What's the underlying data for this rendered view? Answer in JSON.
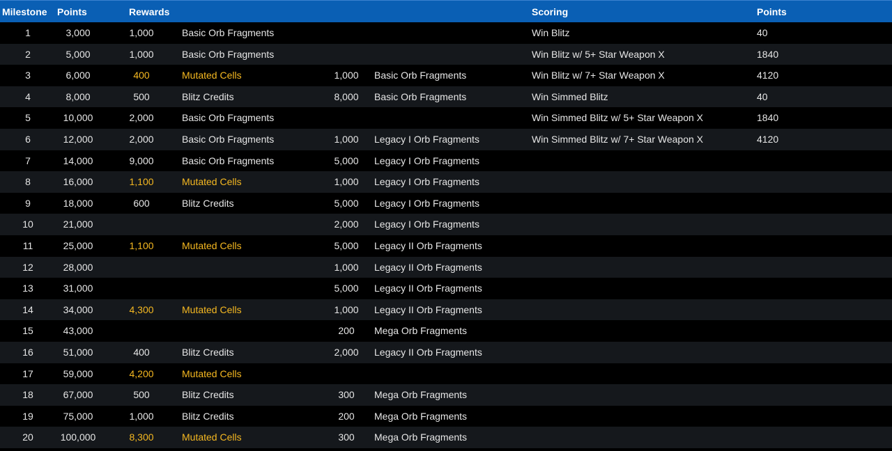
{
  "colors": {
    "header_bg": "#0a5fb4",
    "row_even": "#000000",
    "row_odd": "#15181c",
    "highlight": "#f5b821",
    "text": "#e6e6e6"
  },
  "headers": {
    "milestone": "Milestone",
    "points": "Points",
    "rewards": "Rewards",
    "scoring": "Scoring",
    "scoring_points": "Points"
  },
  "milestones": [
    {
      "n": "1",
      "points": "3,000",
      "r1_qty": "1,000",
      "r1_item": "Basic Orb Fragments",
      "r1_highlight": false,
      "r2_qty": "",
      "r2_item": ""
    },
    {
      "n": "2",
      "points": "5,000",
      "r1_qty": "1,000",
      "r1_item": "Basic Orb Fragments",
      "r1_highlight": false,
      "r2_qty": "",
      "r2_item": ""
    },
    {
      "n": "3",
      "points": "6,000",
      "r1_qty": "400",
      "r1_item": "Mutated Cells",
      "r1_highlight": true,
      "r2_qty": "1,000",
      "r2_item": "Basic Orb Fragments"
    },
    {
      "n": "4",
      "points": "8,000",
      "r1_qty": "500",
      "r1_item": "Blitz Credits",
      "r1_highlight": false,
      "r2_qty": "8,000",
      "r2_item": "Basic Orb Fragments"
    },
    {
      "n": "5",
      "points": "10,000",
      "r1_qty": "2,000",
      "r1_item": "Basic Orb Fragments",
      "r1_highlight": false,
      "r2_qty": "",
      "r2_item": ""
    },
    {
      "n": "6",
      "points": "12,000",
      "r1_qty": "2,000",
      "r1_item": "Basic Orb Fragments",
      "r1_highlight": false,
      "r2_qty": "1,000",
      "r2_item": "Legacy I Orb Fragments"
    },
    {
      "n": "7",
      "points": "14,000",
      "r1_qty": "9,000",
      "r1_item": "Basic Orb Fragments",
      "r1_highlight": false,
      "r2_qty": "5,000",
      "r2_item": "Legacy I Orb Fragments"
    },
    {
      "n": "8",
      "points": "16,000",
      "r1_qty": "1,100",
      "r1_item": "Mutated Cells",
      "r1_highlight": true,
      "r2_qty": "1,000",
      "r2_item": "Legacy I Orb Fragments"
    },
    {
      "n": "9",
      "points": "18,000",
      "r1_qty": "600",
      "r1_item": "Blitz Credits",
      "r1_highlight": false,
      "r2_qty": "5,000",
      "r2_item": "Legacy I Orb Fragments"
    },
    {
      "n": "10",
      "points": "21,000",
      "r1_qty": "",
      "r1_item": "",
      "r1_highlight": false,
      "r2_qty": "2,000",
      "r2_item": "Legacy I Orb Fragments"
    },
    {
      "n": "11",
      "points": "25,000",
      "r1_qty": "1,100",
      "r1_item": "Mutated Cells",
      "r1_highlight": true,
      "r2_qty": "5,000",
      "r2_item": "Legacy II Orb Fragments"
    },
    {
      "n": "12",
      "points": "28,000",
      "r1_qty": "",
      "r1_item": "",
      "r1_highlight": false,
      "r2_qty": "1,000",
      "r2_item": "Legacy II Orb Fragments"
    },
    {
      "n": "13",
      "points": "31,000",
      "r1_qty": "",
      "r1_item": "",
      "r1_highlight": false,
      "r2_qty": "5,000",
      "r2_item": "Legacy II Orb Fragments"
    },
    {
      "n": "14",
      "points": "34,000",
      "r1_qty": "4,300",
      "r1_item": "Mutated Cells",
      "r1_highlight": true,
      "r2_qty": "1,000",
      "r2_item": "Legacy II Orb Fragments"
    },
    {
      "n": "15",
      "points": "43,000",
      "r1_qty": "",
      "r1_item": "",
      "r1_highlight": false,
      "r2_qty": "200",
      "r2_item": "Mega Orb Fragments"
    },
    {
      "n": "16",
      "points": "51,000",
      "r1_qty": "400",
      "r1_item": "Blitz Credits",
      "r1_highlight": false,
      "r2_qty": "2,000",
      "r2_item": "Legacy II Orb Fragments"
    },
    {
      "n": "17",
      "points": "59,000",
      "r1_qty": "4,200",
      "r1_item": "Mutated Cells",
      "r1_highlight": true,
      "r2_qty": "",
      "r2_item": ""
    },
    {
      "n": "18",
      "points": "67,000",
      "r1_qty": "500",
      "r1_item": "Blitz Credits",
      "r1_highlight": false,
      "r2_qty": "300",
      "r2_item": "Mega Orb Fragments"
    },
    {
      "n": "19",
      "points": "75,000",
      "r1_qty": "1,000",
      "r1_item": "Blitz Credits",
      "r1_highlight": false,
      "r2_qty": "200",
      "r2_item": "Mega Orb Fragments"
    },
    {
      "n": "20",
      "points": "100,000",
      "r1_qty": "8,300",
      "r1_item": "Mutated Cells",
      "r1_highlight": true,
      "r2_qty": "300",
      "r2_item": "Mega Orb Fragments"
    }
  ],
  "scoring": [
    {
      "label": "Win Blitz",
      "points": "40"
    },
    {
      "label": "Win Blitz w/ 5+ Star Weapon X",
      "points": "1840"
    },
    {
      "label": "Win Blitz w/ 7+ Star Weapon X",
      "points": "4120"
    },
    {
      "label": "Win Simmed Blitz",
      "points": "40"
    },
    {
      "label": "Win Simmed Blitz w/ 5+ Star Weapon X",
      "points": "1840"
    },
    {
      "label": "Win Simmed Blitz w/ 7+ Star Weapon X",
      "points": "4120"
    }
  ]
}
